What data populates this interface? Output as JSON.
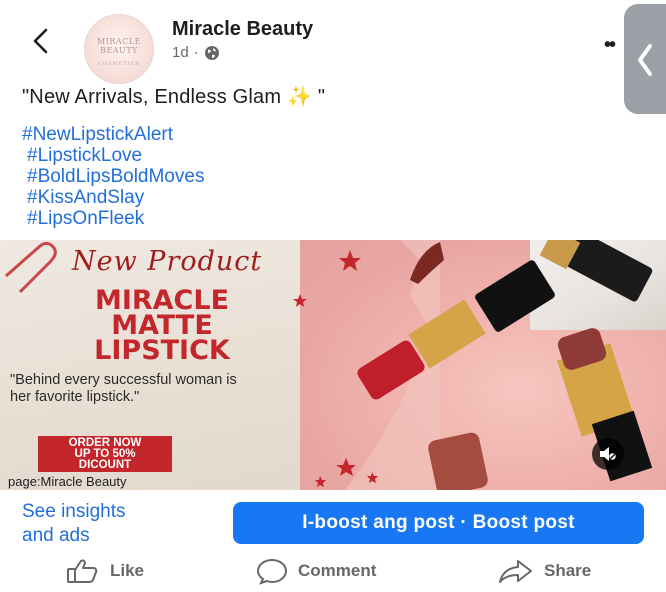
{
  "header": {
    "page_name": "Miracle Beauty",
    "time_ago": "1d",
    "separator": "·",
    "avatar_text": "MIRACLE BEAUTY",
    "avatar_subtext": "COSMETICS"
  },
  "post": {
    "caption": "\"New Arrivals, Endless Glam ✨ \"",
    "hashtags": [
      "#NewLipstickAlert",
      "#LipstickLove",
      "#BoldLipsBoldMoves",
      "#KissAndSlay",
      "#LipsOnFleek"
    ]
  },
  "image": {
    "heading": "New Product",
    "title_lines": [
      "MIRACLE",
      "MATTE",
      "LIPSTICK"
    ],
    "quote": "\"Behind every successful woman is her favorite lipstick.\"",
    "order_lines": [
      "ORDER NOW",
      "UP TO 50%",
      "DICOUNT"
    ],
    "credit": "page:Miracle Beauty"
  },
  "actions": {
    "insights_line1": "See insights",
    "insights_line2": "and ads",
    "boost_label": "I-boost ang post · Boost post"
  },
  "reactions": {
    "like": "Like",
    "comment": "Comment",
    "share": "Share"
  },
  "colors": {
    "link_blue": "#216fdb",
    "boost_blue": "#1877f2",
    "promo_red": "#c4272b"
  },
  "icons": [
    "back-arrow-icon",
    "globe-icon",
    "more-icon",
    "chevron-left-icon",
    "mute-icon",
    "like-icon",
    "comment-icon",
    "share-icon"
  ]
}
